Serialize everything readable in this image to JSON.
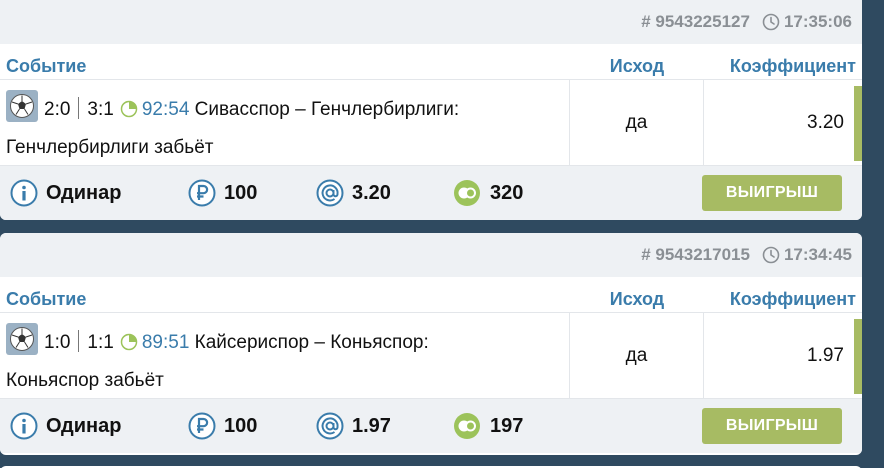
{
  "colors": {
    "background": "#2f4a60",
    "header_blue": "#3a7cab",
    "win_green": "#a7bb63",
    "muted_gray": "#8a8f94"
  },
  "bets": [
    {
      "bet_id": "# 9543225127",
      "time": "17:35:06",
      "headers": {
        "event": "Событие",
        "outcome": "Исход",
        "odds": "Коэффициент"
      },
      "score_total": "2:0",
      "score_half": "3:1",
      "live_time": "92:54",
      "event_text": "Сивасспор – Генчлербирлиги:",
      "market_text": "Генчлербирлиги забьёт",
      "outcome": "да",
      "odds": "3.20",
      "bet_type": "Одинар",
      "stake": "100",
      "coef": "3.20",
      "payout": "320",
      "result_label": "ВЫИГРЫШ",
      "icon": "soccer-ball-icon"
    },
    {
      "bet_id": "# 9543217015",
      "time": "17:34:45",
      "headers": {
        "event": "Событие",
        "outcome": "Исход",
        "odds": "Коэффициент"
      },
      "score_total": "1:0",
      "score_half": "1:1",
      "live_time": "89:51",
      "event_text": "Кайсериспор – Коньяспор:",
      "market_text": "Коньяспор забьёт",
      "outcome": "да",
      "odds": "1.97",
      "bet_type": "Одинар",
      "stake": "100",
      "coef": "1.97",
      "payout": "197",
      "result_label": "ВЫИГРЫШ",
      "icon": "soccer-ball-icon"
    }
  ]
}
